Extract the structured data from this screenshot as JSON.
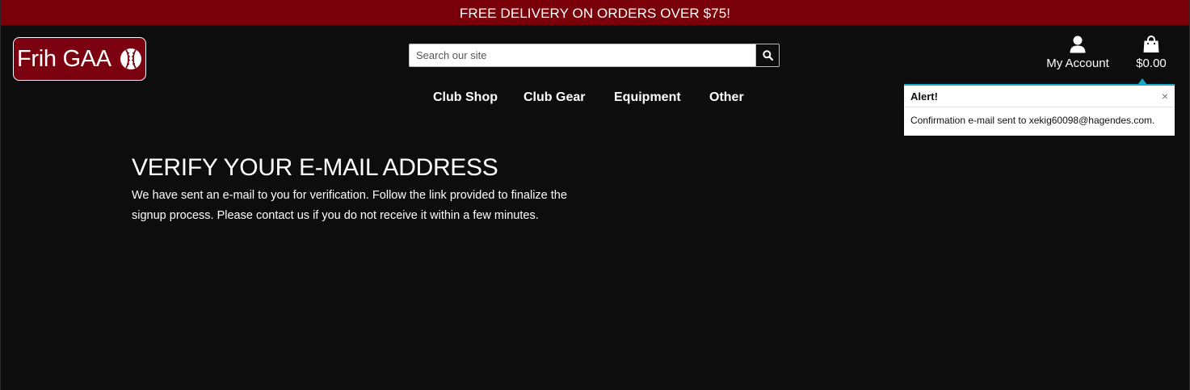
{
  "banner": {
    "text": "FREE DELIVERY ON ORDERS OVER $75!"
  },
  "logo": {
    "text": "Frih GAA",
    "icon": "sliotar-ball-icon"
  },
  "search": {
    "placeholder": "Search our site",
    "value": "",
    "icon": "search-icon"
  },
  "account": {
    "label": "My Account",
    "icon": "user-icon"
  },
  "cart": {
    "total": "$0.00",
    "icon": "shopping-bag-icon"
  },
  "nav": {
    "items": [
      {
        "label": "Club Shop"
      },
      {
        "label": "Club Gear"
      },
      {
        "label": "Equipment"
      },
      {
        "label": "Other"
      }
    ]
  },
  "alert": {
    "title": "Alert!",
    "close": "×",
    "message": "Confirmation e-mail sent to xekig60098@hagendes.com.",
    "accent_color": "#1aa6c8"
  },
  "main": {
    "heading": "VERIFY YOUR E-MAIL ADDRESS",
    "body": "We have sent an e-mail to you for verification. Follow the link provided to finalize the signup process. Please contact us if you do not receive it within a few minutes."
  },
  "colors": {
    "background": "#0d0d0d",
    "brand": "#7a0009",
    "text": "#ffffff"
  }
}
